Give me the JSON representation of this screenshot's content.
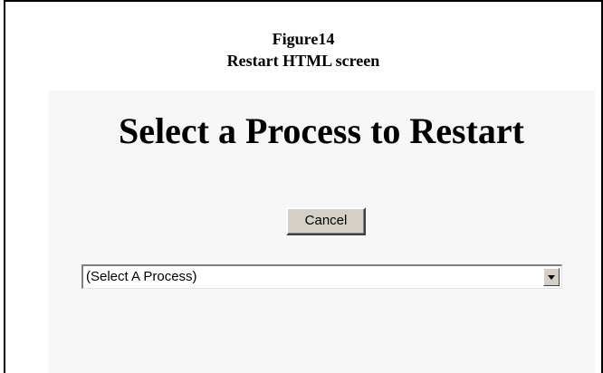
{
  "caption": {
    "line1": "Figure14",
    "line2": "Restart HTML screen"
  },
  "page": {
    "heading": "Select a Process to Restart",
    "cancel_label": "Cancel",
    "process_select": {
      "selected": "(Select A Process)"
    }
  },
  "colors": {
    "panel_background": "#f7f7f7",
    "button_face": "#d4d0c8",
    "frame_border": "#000000"
  },
  "icons": {
    "dropdown": "chevron-down-icon"
  }
}
